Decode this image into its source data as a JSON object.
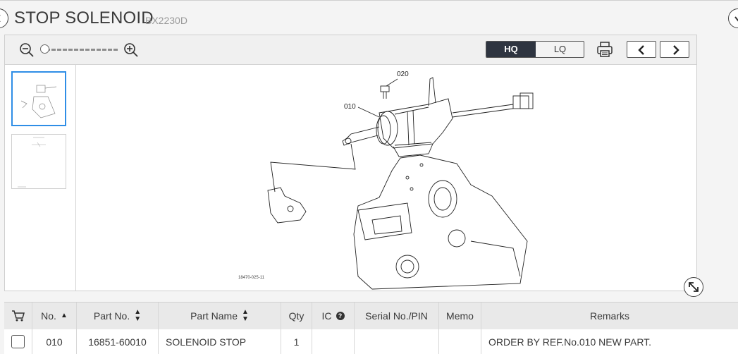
{
  "header": {
    "title": "STOP SOLENOID",
    "model": "BX2230D"
  },
  "toolbar": {
    "zoom_out_icon": "zoom-out-icon",
    "zoom_in_icon": "zoom-in-icon",
    "zoom_level": 0,
    "quality_options": [
      "HQ",
      "LQ"
    ],
    "selected_quality": "HQ",
    "print_icon": "printer-icon",
    "prev_icon": "chevron-left-icon",
    "next_icon": "chevron-right-icon"
  },
  "thumbnails": [
    {
      "name": "page-1",
      "active": true
    },
    {
      "name": "page-2",
      "active": false
    }
  ],
  "diagram": {
    "callouts": [
      "010",
      "020"
    ],
    "code": "18470-025-11"
  },
  "table": {
    "headers": [
      "No.",
      "Part No.",
      "Part Name",
      "Qty",
      "IC",
      "Serial No./PIN",
      "Memo",
      "Remarks"
    ],
    "rows": [
      {
        "no": "010",
        "part_no": "16851-60010",
        "part_name": "SOLENOID STOP",
        "qty": "1",
        "ic": "",
        "serial": "",
        "memo": "",
        "remarks": "ORDER BY REF.No.010 NEW PART."
      }
    ]
  },
  "colors": {
    "accent": "#2f8ee6",
    "hq_bg": "#2e3440"
  }
}
